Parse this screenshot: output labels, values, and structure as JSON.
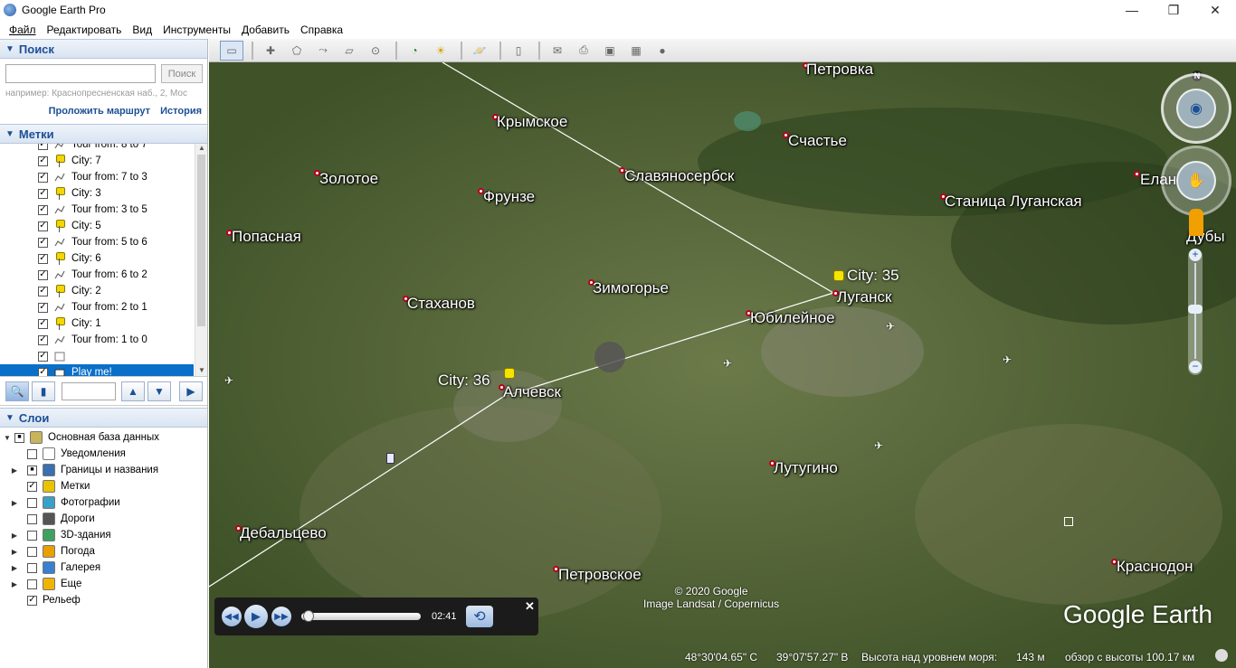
{
  "window": {
    "title": "Google Earth Pro",
    "minimize": "—",
    "maximize": "❐",
    "close": "✕"
  },
  "menu": [
    "Файл",
    "Редактировать",
    "Вид",
    "Инструменты",
    "Добавить",
    "Справка"
  ],
  "search": {
    "header": "Поиск",
    "placeholder": "",
    "button": "Поиск",
    "hint": "например: Краснопресненская наб., 2, Мос",
    "route_link": "Проложить маршрут",
    "history_link": "История"
  },
  "places": {
    "header": "Метки",
    "items": [
      {
        "label": "Tour from: 8 to 7",
        "type": "path"
      },
      {
        "label": "City: 7",
        "type": "pin"
      },
      {
        "label": "Tour from: 7 to 3",
        "type": "path"
      },
      {
        "label": "City: 3",
        "type": "pin"
      },
      {
        "label": "Tour from: 3 to 5",
        "type": "path"
      },
      {
        "label": "City: 5",
        "type": "pin"
      },
      {
        "label": "Tour from: 5 to 6",
        "type": "path"
      },
      {
        "label": "City: 6",
        "type": "pin"
      },
      {
        "label": "Tour from: 6 to 2",
        "type": "path"
      },
      {
        "label": "City: 2",
        "type": "pin"
      },
      {
        "label": "Tour from: 2 to 1",
        "type": "path"
      },
      {
        "label": "City: 1",
        "type": "pin"
      },
      {
        "label": "Tour from: 1 to 0",
        "type": "path"
      },
      {
        "label": "",
        "type": "folder"
      },
      {
        "label": "Play me!",
        "type": "tour",
        "selected": true
      }
    ]
  },
  "layers": {
    "header": "Слои",
    "items": [
      {
        "label": "Основная база данных",
        "checked": "partial",
        "icon": "database-icon",
        "color": "#c8b45a",
        "expander": false
      },
      {
        "label": "Уведомления",
        "checked": "none",
        "icon": "envelope-icon",
        "color": "#ffffff",
        "expander": false
      },
      {
        "label": "Границы и названия",
        "checked": "partial",
        "icon": "flag-icon",
        "color": "#3a6fb0",
        "expander": true
      },
      {
        "label": "Метки",
        "checked": "checked",
        "icon": "places-icon",
        "color": "#e8c400",
        "expander": false
      },
      {
        "label": "Фотографии",
        "checked": "none",
        "icon": "photo-icon",
        "color": "#3aa0c8",
        "expander": true
      },
      {
        "label": "Дороги",
        "checked": "none",
        "icon": "road-icon",
        "color": "#555555",
        "expander": false
      },
      {
        "label": "3D-здания",
        "checked": "none",
        "icon": "buildings-icon",
        "color": "#3fa060",
        "expander": true
      },
      {
        "label": "Погода",
        "checked": "none",
        "icon": "sun-icon",
        "color": "#e8a000",
        "expander": true
      },
      {
        "label": "Галерея",
        "checked": "none",
        "icon": "star-icon",
        "color": "#3a7fd0",
        "expander": true
      },
      {
        "label": "Еще",
        "checked": "none",
        "icon": "more-icon",
        "color": "#f0b400",
        "expander": true
      },
      {
        "label": "Рельеф",
        "checked": "checked",
        "icon": "",
        "color": "",
        "expander": false
      }
    ]
  },
  "map": {
    "cities": [
      "Петровка",
      "Крымское",
      "Счастье",
      "Славяносербск",
      "Золотое",
      "Фрунзе",
      "Станица Луганская",
      "Елан",
      "Попасная",
      "Дубы",
      "Зимогорье",
      "Стаханов",
      "Луганск",
      "Юбилейное",
      "Алчевск",
      "Лутугино",
      "Дебальцево",
      "Петровское",
      "Краснодон"
    ],
    "placemarks": [
      "City: 35",
      "City: 36"
    ],
    "compass_north": "N",
    "credit_line1": "© 2020 Google",
    "credit_line2": "Image Landsat / Copernicus",
    "logo": "Google Earth"
  },
  "tour": {
    "time": "02:41",
    "progress": 0.03
  },
  "status": {
    "lat": "48°30'04.65\" С",
    "lon": "39°07'57.27\" В",
    "elev_label": "Высота над уровнем моря:",
    "elev_value": "143 м",
    "eye": "обзор с высоты 100.17 км"
  },
  "colors": {
    "header_blue": "#1c4f96",
    "selection": "#0a6fc9",
    "map_bg": "#4e6034"
  }
}
